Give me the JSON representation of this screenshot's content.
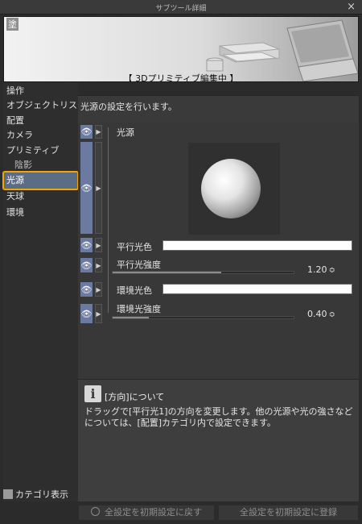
{
  "window": {
    "title": "サブツール詳細",
    "close_glyph": "×"
  },
  "preview": {
    "ghost_label": "塗",
    "status": "【 3Dプリミティブ編集中 】"
  },
  "categories": [
    {
      "label": "操作"
    },
    {
      "label": "オブジェクトリスト"
    },
    {
      "label": "配置"
    },
    {
      "label": "カメラ"
    },
    {
      "label": "プリミティブ"
    },
    {
      "label": "陰影"
    },
    {
      "label": "光源"
    },
    {
      "label": "天球"
    },
    {
      "label": "環境"
    }
  ],
  "selected_category": "光源",
  "category_toggle_label": "カテゴリ表示",
  "description": "光源の設定を行います。",
  "icons": {
    "eye": "👁",
    "expand": "▶",
    "spin": "≎"
  },
  "settings": {
    "light_source_label": "光源",
    "parallel_color_label": "平行光色",
    "parallel_color": "#ffffff",
    "parallel_strength_label": "平行光強度",
    "parallel_strength_value": "1.20",
    "parallel_strength_fill": 0.6,
    "ambient_color_label": "環境光色",
    "ambient_color": "#ffffff",
    "ambient_strength_label": "環境光強度",
    "ambient_strength_value": "0.40",
    "ambient_strength_fill": 0.2
  },
  "info": {
    "icon_glyph": "i",
    "heading": "[方向]について",
    "body": "ドラッグで[平行光1]の方向を変更します。他の光源や光の強さなどについては、[配置]カテゴリ内で設定できます。"
  },
  "footer": {
    "reset_label": "全設定を初期設定に戻す",
    "register_label": "全設定を初期設定に登録"
  },
  "colors": {
    "accent_highlight": "#f0a500",
    "selection_bg": "#5c6b86",
    "eye_button": "#6b7aa0"
  }
}
